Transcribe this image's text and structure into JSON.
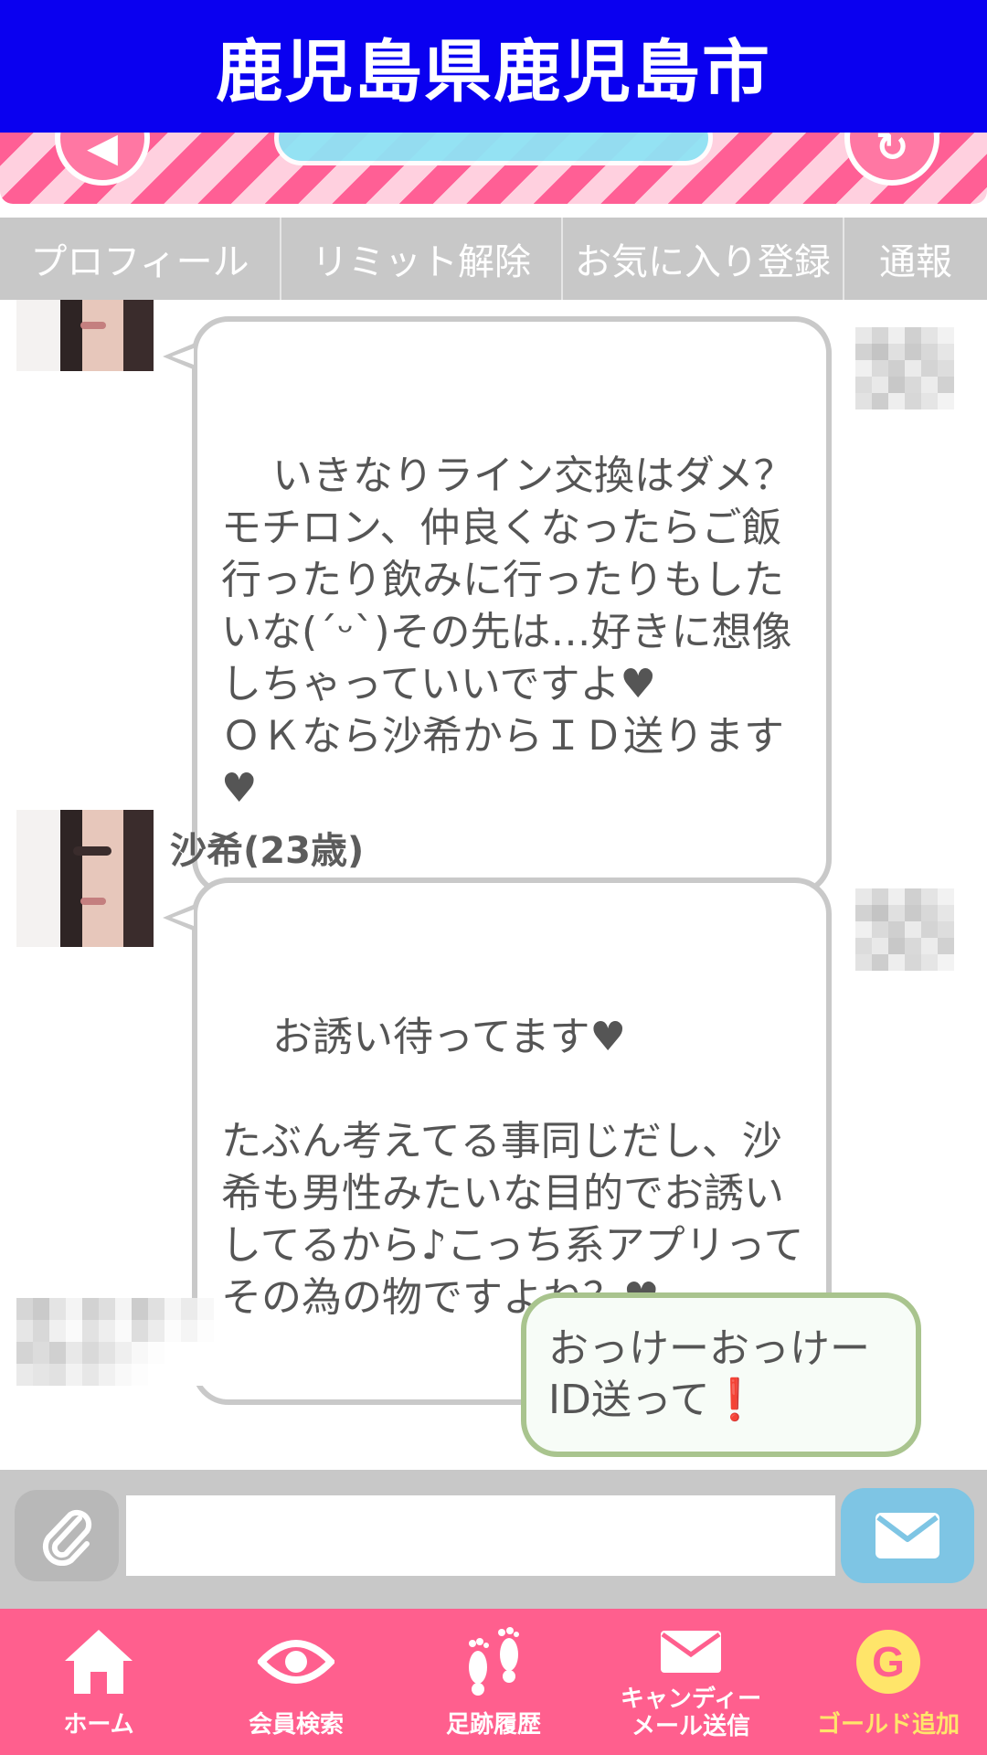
{
  "header": {
    "title": "鹿児島県鹿児島市"
  },
  "tabs": [
    {
      "label": "プロフィール"
    },
    {
      "label": "リミット解除"
    },
    {
      "label": "お気に入り登録"
    },
    {
      "label": "通報"
    }
  ],
  "messages": {
    "msg1": {
      "text": "いきなりライン交換はダメ？モチロン、仲良くなったらご飯行ったり飲みに行ったりもしたいな(´ᵕ`)その先は…好きに想像しちゃっていいですよ♥\nＯＫなら沙希からＩＤ送ります♥"
    },
    "msg2": {
      "sender": "沙希(23歳)",
      "text": "お誘い待ってます♥\n\nたぶん考えてる事同じだし、沙希も男性みたいな目的でお誘いしてるから♪こっち系アプリってその為の物ですよね？♥"
    },
    "msg3": {
      "text": "おっけーおっけー\nID送って",
      "emphasis": "❗"
    }
  },
  "composer": {
    "placeholder": ""
  },
  "bottom_nav": [
    {
      "label": "ホーム",
      "icon": "home-icon"
    },
    {
      "label": "会員検索",
      "icon": "eye-icon"
    },
    {
      "label": "足跡履歴",
      "icon": "footprints-icon"
    },
    {
      "label": "キャンディー\nメール送信",
      "icon": "mail-icon"
    },
    {
      "label": "ゴールド追加",
      "icon": "gold-g-icon"
    }
  ],
  "colors": {
    "header_bg": "#0a00f0",
    "bottom_nav_bg": "#ff5f8e",
    "tab_bg": "#c8c8c8",
    "outgoing_border": "#a9c48e",
    "send_button": "#7ec5e4",
    "gold_label": "#ffe56a"
  }
}
